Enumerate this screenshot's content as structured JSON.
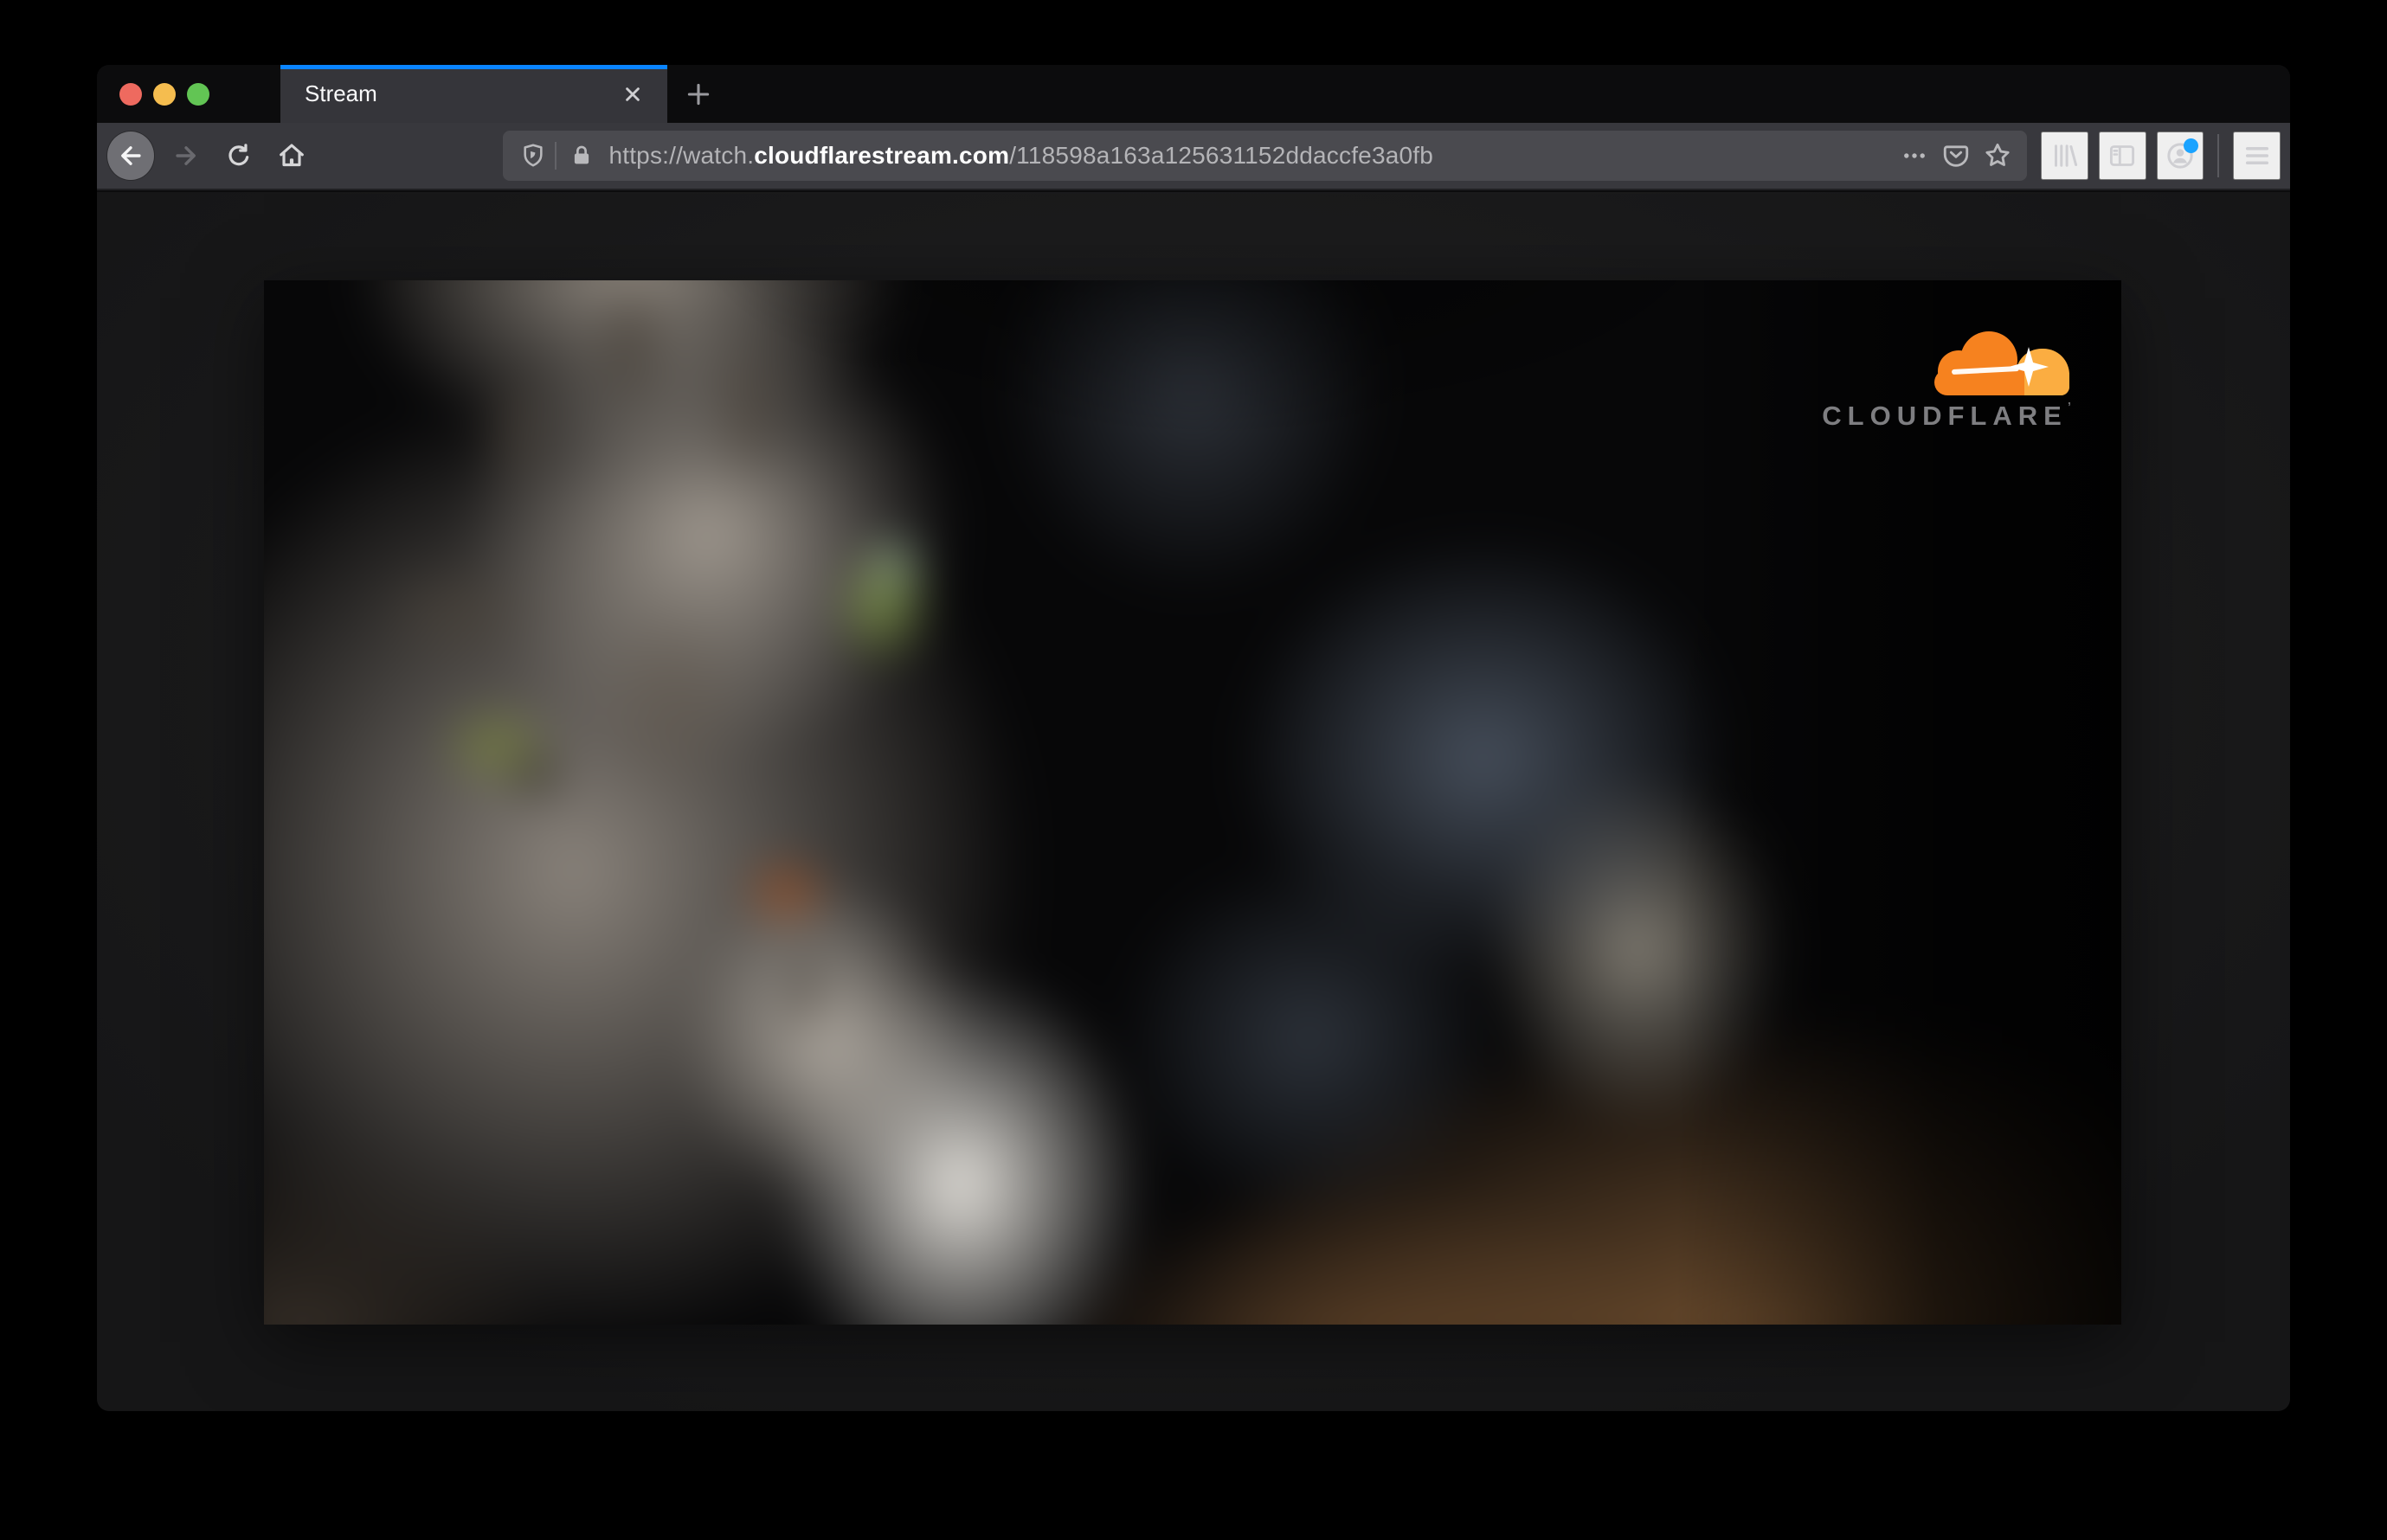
{
  "tab_bar": {
    "active_tab": {
      "label": "Stream"
    }
  },
  "toolbar": {
    "url": {
      "prefix": "https://watch.",
      "domain": "cloudflarestream.com",
      "path": "/118598a163a125631152ddaccfe3a0fb"
    },
    "icons": [
      "back-icon",
      "forward-icon",
      "reload-icon",
      "home-icon",
      "shield-icon",
      "lock-icon",
      "page-actions-icon",
      "pocket-icon",
      "bookmark-star-icon",
      "library-icon",
      "sidebar-icon",
      "account-icon",
      "menu-icon"
    ]
  },
  "video": {
    "brand": "CLOUDFLARE",
    "trademark": "’"
  },
  "colors": {
    "tab_accent_blue": "#0a84ff",
    "account_badge_blue": "#1aa3ff",
    "cloudflare_orange": "#f6821f",
    "cloudflare_light_orange": "#fbad41",
    "brand_text_gray": "#7e7e81",
    "toolbar_gray": "#38383d",
    "urlbar_gray": "#4a4a4f",
    "tabbar_black": "#0c0c0d"
  }
}
